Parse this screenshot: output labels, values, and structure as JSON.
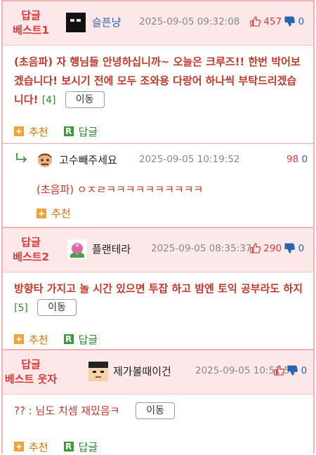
{
  "posts": [
    {
      "badge_line1": "답글",
      "badge_line2": "베스트1",
      "nickname": "슬픈냥",
      "date": "2025-09-05 09:32:08",
      "up": "457",
      "down": "0",
      "content": "(초음파) 자 행님들 안녕하십니까~ 오늘은 크루즈!! 한번 박어보겠습니다! 보시기 전에 모두 조와용 다랑어 하나씩 부탁드리겠습니다!",
      "comment_count": "[4]",
      "move_label": "이동",
      "recommend_label": "추천",
      "reply_label": "답글"
    },
    {
      "badge_line1": "답글",
      "badge_line2": "베스트2",
      "nickname": "플랜테라",
      "date": "2025-09-05 08:35:37",
      "up": "290",
      "down": "0",
      "content": "방향타 가지고 놀 시간 있으면 투잡 하고 밤엔 토익 공부라도 하지",
      "comment_count": "[5]",
      "move_label": "이동",
      "recommend_label": "추천",
      "reply_label": "답글"
    },
    {
      "badge_line1": "답글",
      "badge_line2": "베스트 웃자",
      "nickname": "제가볼때이건",
      "date": "2025-09-05 10:51:52",
      "up": "",
      "down": "0",
      "content": "?? : 님도 치셈 재밌음ㅋ",
      "move_label": "이동",
      "recommend_label": "추천",
      "reply_label": "답글"
    }
  ],
  "reply": {
    "nickname": "고수빼주세요",
    "date": "2025-09-05 10:19:52",
    "up": "98",
    "down": "0",
    "content": "(초음파) ㅇㅈㄹㅋㅋㅋㅋㅋㅋㅋㅋㅋㅋ",
    "recommend_label": "추천"
  },
  "icons": {
    "up": "thumbs-up-icon",
    "down": "thumbs-down-icon",
    "reply_arrow": "reply-arrow-icon",
    "recommend": "plus-square-icon",
    "reply": "r-square-icon"
  },
  "colors": {
    "accent_red": "#d63a3a",
    "border_pink": "#f3b2b2",
    "header_bg": "#fce8e9",
    "blue": "#2a64b0",
    "green": "#2e8b2e",
    "orange": "#d67200"
  }
}
